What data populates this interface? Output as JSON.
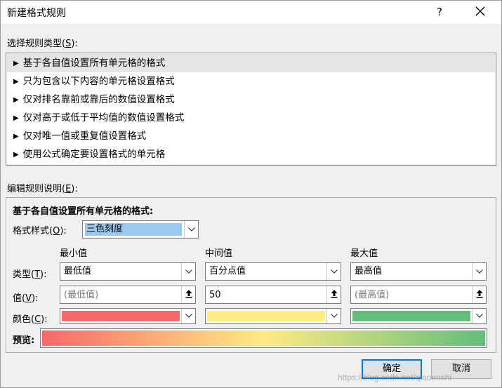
{
  "window": {
    "title": "新建格式规则",
    "help_label": "?"
  },
  "rule_type": {
    "label": "选择规则类型(",
    "accel": "S",
    "label_end": "):",
    "items": [
      {
        "label": "基于各自值设置所有单元格的格式",
        "selected": true
      },
      {
        "label": "只为包含以下内容的单元格设置格式",
        "selected": false
      },
      {
        "label": "仅对排名靠前或靠后的数值设置格式",
        "selected": false
      },
      {
        "label": "仅对高于或低于平均值的数值设置格式",
        "selected": false
      },
      {
        "label": "仅对唯一值或重复值设置格式",
        "selected": false
      },
      {
        "label": "使用公式确定要设置格式的单元格",
        "selected": false
      }
    ]
  },
  "edit": {
    "label": "编辑规则说明(",
    "accel": "E",
    "label_end": "):",
    "title": "基于各自值设置所有单元格的格式:",
    "format_style": {
      "label": "格式样式(",
      "accel": "O",
      "label_end": "):",
      "value": "三色刻度"
    },
    "columns": {
      "min": "最小值",
      "mid": "中间值",
      "max": "最大值"
    },
    "type_label": {
      "text": "类型(",
      "accel": "T",
      "end": "):"
    },
    "value_label": {
      "text": "值(",
      "accel": "V",
      "end": "):"
    },
    "color_label": {
      "text": "颜色(",
      "accel": "C",
      "end": "):"
    },
    "min": {
      "type": "最低值",
      "value": "(最低值)",
      "color": "#f8696b"
    },
    "mid": {
      "type": "百分点值",
      "value": "50",
      "color": "#ffeb84"
    },
    "max": {
      "type": "最高值",
      "value": "(最高值)",
      "color": "#63be7b"
    },
    "preview_label": "预览:"
  },
  "buttons": {
    "ok": "确定",
    "cancel": "取消"
  },
  "watermark": "https://blog.csdn.net/qiaoenshi"
}
